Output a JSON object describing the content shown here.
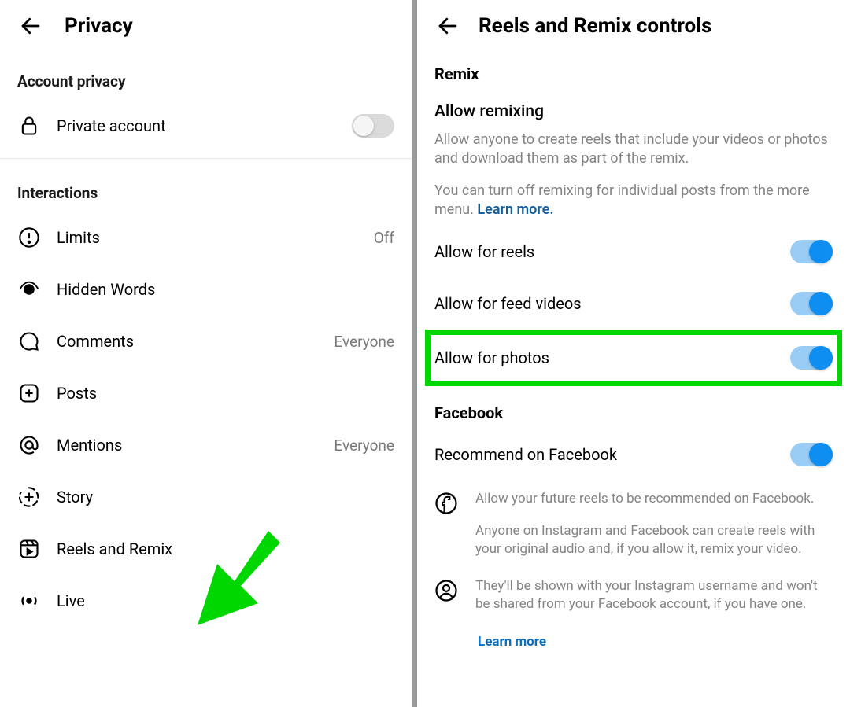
{
  "left": {
    "title": "Privacy",
    "account_section": "Account privacy",
    "private_account": {
      "label": "Private account",
      "on": false
    },
    "interactions_section": "Interactions",
    "items": [
      {
        "label": "Limits",
        "value": "Off"
      },
      {
        "label": "Hidden Words",
        "value": ""
      },
      {
        "label": "Comments",
        "value": "Everyone"
      },
      {
        "label": "Posts",
        "value": ""
      },
      {
        "label": "Mentions",
        "value": "Everyone"
      },
      {
        "label": "Story",
        "value": ""
      },
      {
        "label": "Reels and Remix",
        "value": ""
      },
      {
        "label": "Live",
        "value": ""
      }
    ]
  },
  "right": {
    "title": "Reels and Remix controls",
    "remix_section": "Remix",
    "allow_remixing_heading": "Allow remixing",
    "desc1": "Allow anyone to create reels that include your videos or photos and download them as part of the remix.",
    "desc2_pre": "You can turn off remixing for individual posts from the more menu. ",
    "desc2_link": "Learn more.",
    "toggles": [
      {
        "label": "Allow for reels",
        "on": true
      },
      {
        "label": "Allow for feed videos",
        "on": true
      },
      {
        "label": "Allow for photos",
        "on": true
      }
    ],
    "facebook_section": "Facebook",
    "recommend": {
      "label": "Recommend on Facebook",
      "on": true
    },
    "info1": "Allow your future reels to be recommended on Facebook.",
    "info2": "Anyone on Instagram and Facebook can create reels with your original audio and, if you allow it, remix your video.",
    "info3": "They'll be shown with your Instagram username and won't be shared from your Facebook account, if you have one.",
    "learn_more": "Learn more"
  }
}
